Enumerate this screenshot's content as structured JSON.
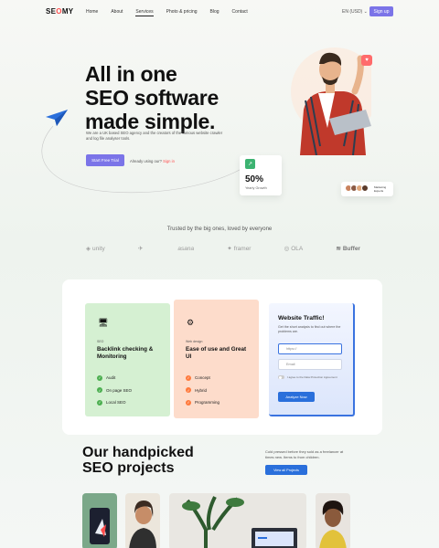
{
  "brand": {
    "logo_text_1": "SE",
    "logo_text_2": "O",
    "logo_text_3": "MY"
  },
  "nav": {
    "items": [
      {
        "label": "Home"
      },
      {
        "label": "About"
      },
      {
        "label": "Services"
      },
      {
        "label": "Photo & pricing"
      },
      {
        "label": "Blog"
      },
      {
        "label": "Contact"
      }
    ],
    "active": "Services",
    "language": "EN (USD)",
    "signup_label": "Sign up"
  },
  "hero": {
    "title_line_1": "All in one",
    "title_line_2": "SEO software",
    "title_line_3": "made simple.",
    "description": "We are a UK based SEO agency and the creators of the famous website crawler and log file analyser tools.",
    "cta_label": "Start Free Trial",
    "have_account": "Already using our?",
    "sign_in": "Sign in",
    "stat_value": "50%",
    "stat_label": "Yearly Growth",
    "team_label": "Marketing Experts"
  },
  "trusted": {
    "heading": "Trusted by the big ones, loved by everyone",
    "logos": [
      "unity",
      "",
      "asana",
      "framer",
      "OLA",
      "Buffer"
    ]
  },
  "features": [
    {
      "tag": "SEO",
      "title": "Backlink checking & Monitoring",
      "items": [
        "Audit",
        "On page SEO",
        "Local SEO"
      ]
    },
    {
      "tag": "Web design",
      "title": "Ease of use and Great UI",
      "items": [
        "Concept",
        "Hybrid",
        "Programming"
      ]
    }
  ],
  "traffic": {
    "title": "Website Traffic!",
    "description": "Get the short analysis to find out where the problems are.",
    "url_placeholder": "https://",
    "email_placeholder": "Email",
    "consent": "I agree to the Data Protection Agreement",
    "button": "Analyze Now"
  },
  "projects": {
    "title_line_1": "Our handpicked",
    "title_line_2": "SEO projects",
    "description": "Cold pressed before they sold as a freelancer at times new. Items to from children.",
    "button": "View all Projects"
  },
  "colors": {
    "accent": "#7b74e8",
    "blue": "#2a6fdb",
    "green": "#d5f0d2",
    "orange": "#fddccb"
  }
}
